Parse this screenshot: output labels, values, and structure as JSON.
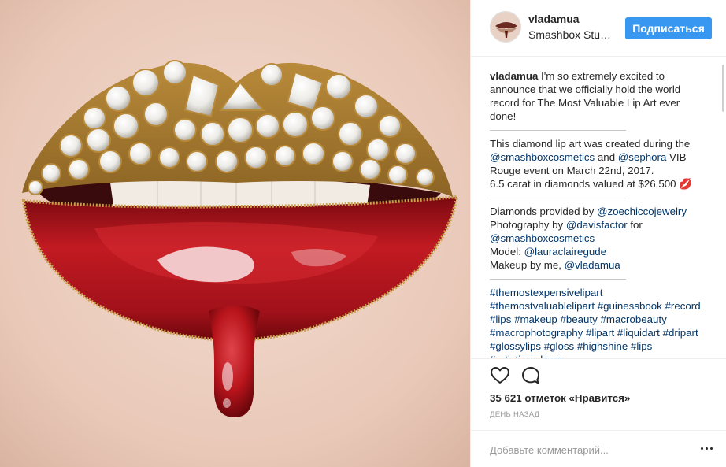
{
  "post": {
    "image_alt": "Diamond lip art",
    "username": "vladamua",
    "location": "Smashbox Stu…",
    "follow_label": "Подписаться"
  },
  "caption": {
    "username": "vladamua",
    "intro": " I'm so extremely excited to announce that we officially hold the world record for The Most Valuable Lip Art ever done!",
    "p2_a": "This diamond lip art was created during the ",
    "p2_link1": "@smashboxcosmetics",
    "p2_b": " and ",
    "p2_link2": "@sephora",
    "p2_c": " VIB Rouge event on March 22nd, 2017.",
    "p2_d": "6.5 carat in diamonds valued at $26,500 ",
    "p2_emoji": "💋",
    "p3_a": "Diamonds provided by ",
    "p3_link1": "@zoechiccojewelry",
    "p3_b": "Photography by ",
    "p3_link2": "@davisfactor",
    "p3_c": " for",
    "p3_link3": "@smashboxcosmetics",
    "p3_d": "Model: ",
    "p3_link4": "@lauraclairegude",
    "p3_e": "Makeup by me, ",
    "p3_link5": "@vladamua",
    "hashtags": [
      "#themostexpensivelipart",
      "#themostvaluablelipart",
      "#guinessbook",
      "#record",
      "#lips",
      "#makeup",
      "#beauty",
      "#macrobeauty",
      "#macrophotography",
      "#lipart",
      "#liquidart",
      "#dripart",
      "#glossylips",
      "#gloss",
      "#highshine",
      "#lips",
      "#artisticmakeup"
    ]
  },
  "actions": {
    "like_icon": "heart-icon",
    "comment_icon": "comment-icon",
    "likes_text": "35 621 отметок «Нравится»",
    "time_text": "День назад"
  },
  "comment_box": {
    "placeholder": "Добавьте комментарий...",
    "more_icon": "more-options-icon"
  },
  "colors": {
    "accent": "#3897f0",
    "link": "#003569",
    "lip_red": "#b3131b",
    "gold": "#c9a04a"
  }
}
